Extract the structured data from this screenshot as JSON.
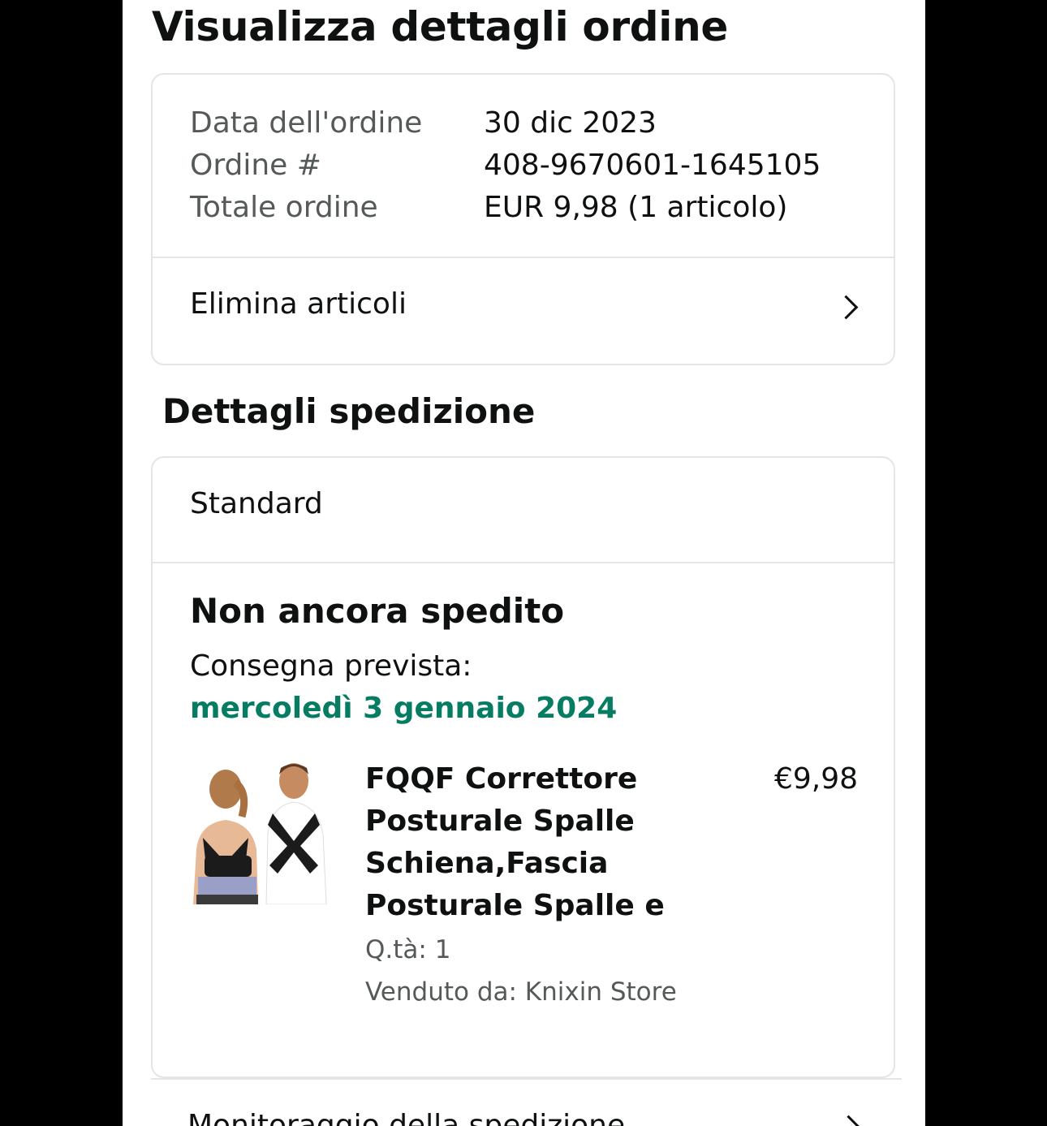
{
  "header": {
    "title": "Visualizza dettagli ordine"
  },
  "order_summary": {
    "rows": [
      {
        "label": "Data dell'ordine",
        "value": "30 dic 2023"
      },
      {
        "label": "Ordine #",
        "value": "408-9670601-1645105"
      },
      {
        "label": "Totale ordine",
        "value": "EUR 9,98 (1 articolo)"
      }
    ],
    "action_label": "Elimina articoli"
  },
  "shipment": {
    "section_title": "Dettagli spedizione",
    "method": "Standard",
    "status": "Non ancora spedito",
    "delivery_label": "Consegna prevista:",
    "delivery_date": "mercoledì 3 gennaio 2024",
    "delivery_date_color": "#067d62",
    "item": {
      "title": "FQQF Correttore Posturale Spalle Schiena,Fascia Posturale Spalle e",
      "price": "€9,98",
      "quantity": "Q.tà: 1",
      "seller": "Venduto da: Knixin Store",
      "image_icon": "posture-corrector-product-image"
    }
  },
  "tracking": {
    "label": "Monitoraggio della spedizione"
  },
  "icons": {
    "chevron": "chevron-right-icon"
  }
}
